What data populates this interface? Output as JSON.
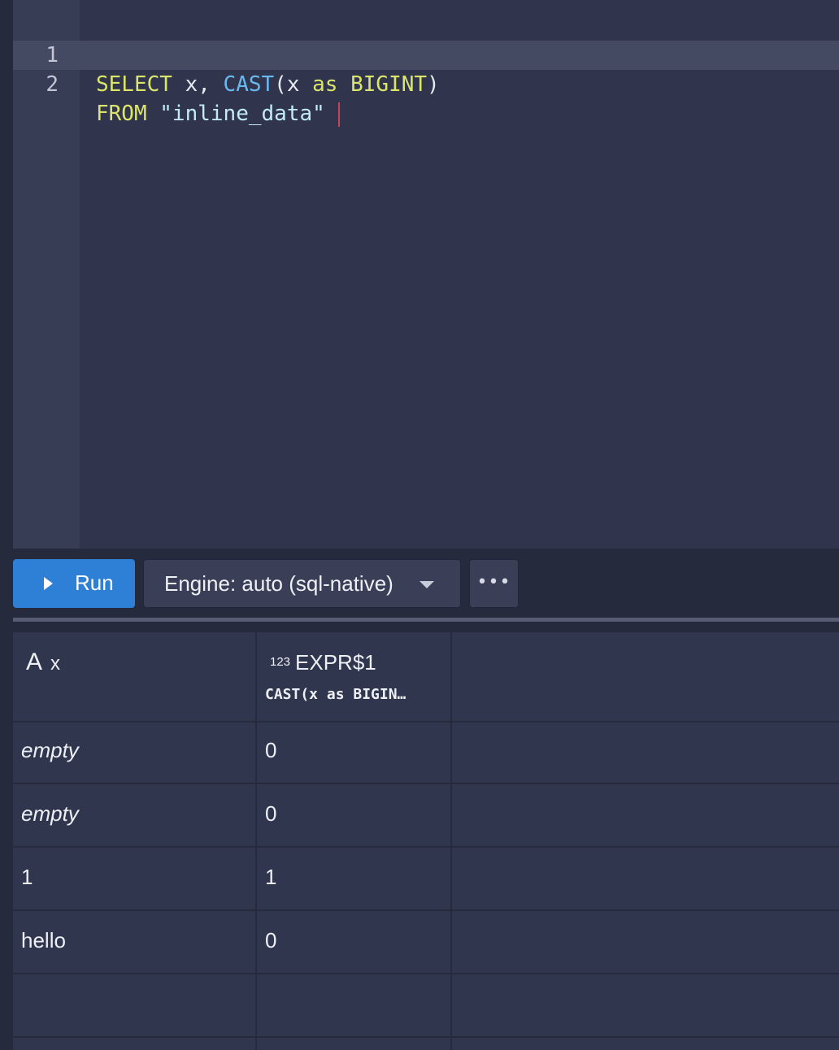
{
  "editor": {
    "lines": [
      {
        "num": "1",
        "tokens": [
          "SELECT",
          " x, ",
          "CAST",
          "(x ",
          "as",
          " ",
          "BIGINT",
          ")"
        ]
      },
      {
        "num": "2",
        "tokens": [
          "FROM",
          " ",
          "\"inline_data\""
        ]
      }
    ]
  },
  "toolbar": {
    "run_label": "Run",
    "engine_label": "Engine: auto (sql-native)",
    "more_label": "•••"
  },
  "results": {
    "columns": [
      {
        "type_icon": "A",
        "name": "x",
        "subtitle": ""
      },
      {
        "type_icon": "123",
        "name": "EXPR$1",
        "subtitle": "CAST(x as BIGIN…"
      }
    ],
    "rows": [
      {
        "x": "empty",
        "x_italic": true,
        "expr": "0"
      },
      {
        "x": "empty",
        "x_italic": true,
        "expr": "0"
      },
      {
        "x": "1",
        "x_italic": false,
        "expr": "1"
      },
      {
        "x": "hello",
        "x_italic": false,
        "expr": "0"
      }
    ]
  }
}
